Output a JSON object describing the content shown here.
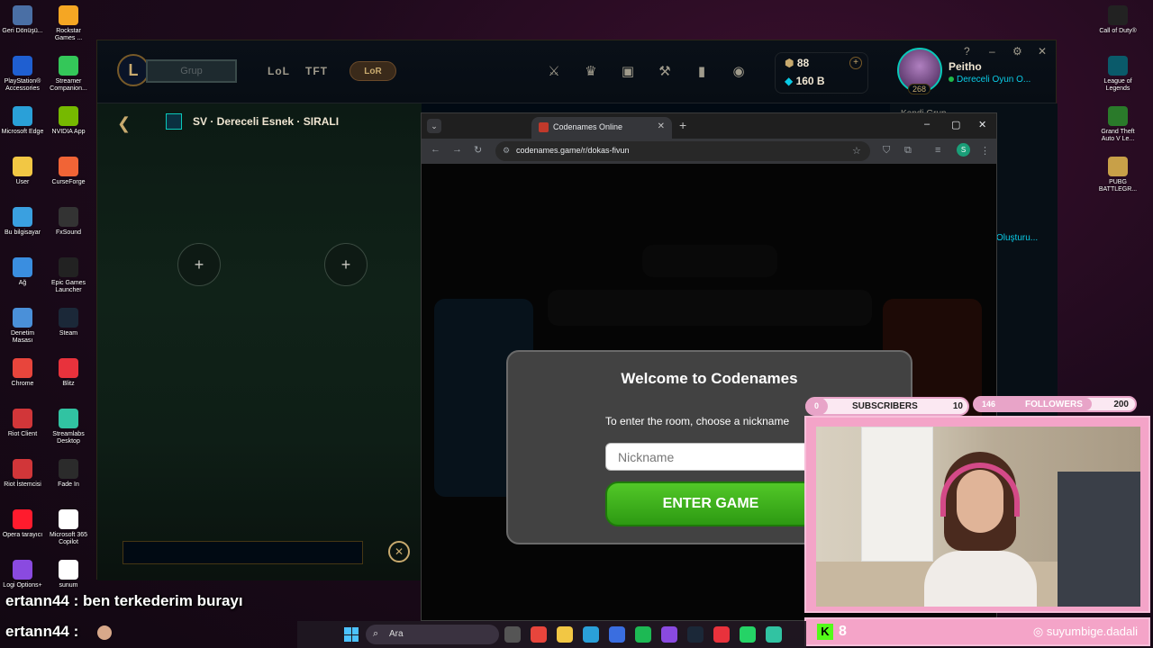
{
  "desktop": {
    "left_icons": [
      {
        "label": "Geri Dönüşü...",
        "icon": "recycle-bin-icon",
        "color": "#4a6fa5"
      },
      {
        "label": "Rockstar Games ...",
        "icon": "rockstar-icon",
        "color": "#f5a623"
      },
      {
        "label": "PlayStation® Accessories",
        "icon": "playstation-icon",
        "color": "#1f5fd1"
      },
      {
        "label": "Streamer Companion...",
        "icon": "streamer-icon",
        "color": "#34c759"
      },
      {
        "label": "Microsoft Edge",
        "icon": "edge-icon",
        "color": "#2aa0d8"
      },
      {
        "label": "NVIDIA App",
        "icon": "nvidia-icon",
        "color": "#76b900"
      },
      {
        "label": "User",
        "icon": "folder-icon",
        "color": "#f2c744"
      },
      {
        "label": "CurseForge",
        "icon": "curseforge-icon",
        "color": "#f16436"
      },
      {
        "label": "Bu bilgisayar",
        "icon": "computer-icon",
        "color": "#3aa0e0"
      },
      {
        "label": "FxSound",
        "icon": "fxsound-icon",
        "color": "#333333"
      },
      {
        "label": "Ağ",
        "icon": "network-icon",
        "color": "#3a8ee0"
      },
      {
        "label": "Epic Games Launcher",
        "icon": "epic-icon",
        "color": "#222222"
      },
      {
        "label": "Denetim Masası",
        "icon": "control-panel-icon",
        "color": "#4a90d9"
      },
      {
        "label": "Steam",
        "icon": "steam-icon",
        "color": "#1b2838"
      },
      {
        "label": "Chrome",
        "icon": "chrome-icon",
        "color": "#e8453c"
      },
      {
        "label": "Blitz",
        "icon": "blitz-icon",
        "color": "#e8323c"
      },
      {
        "label": "Riot Client",
        "icon": "riot-icon",
        "color": "#d13639"
      },
      {
        "label": "Streamlabs Desktop",
        "icon": "streamlabs-icon",
        "color": "#31c3a2"
      },
      {
        "label": "Riot İstemcisi",
        "icon": "riot-icon",
        "color": "#d13639"
      },
      {
        "label": "Fade In",
        "icon": "fadein-icon",
        "color": "#2b2b2b"
      },
      {
        "label": "Opera tarayıcı",
        "icon": "opera-icon",
        "color": "#ff1b2d"
      },
      {
        "label": "Microsoft 365 Copilot",
        "icon": "document-icon",
        "color": "#ffffff"
      },
      {
        "label": "Logi Options+",
        "icon": "logi-icon",
        "color": "#8a4ae0"
      },
      {
        "label": "sunum",
        "icon": "document-icon",
        "color": "#ffffff"
      }
    ],
    "right_icons": [
      {
        "label": "Call of Duty®",
        "icon": "cod-icon",
        "color": "#222222"
      },
      {
        "label": "League of Legends",
        "icon": "lol-icon",
        "color": "#0a5a6a"
      },
      {
        "label": "Grand Theft Auto V Le...",
        "icon": "gta-icon",
        "color": "#2a7a2a"
      },
      {
        "label": "PUBG BATTLEGR...",
        "icon": "pubg-icon",
        "color": "#c8a048"
      }
    ]
  },
  "lol_client": {
    "play_label": "Grup",
    "nav": [
      "LoL",
      "TFT"
    ],
    "lor_label": "LoR",
    "currency": {
      "rp": "88",
      "essence": "160 B"
    },
    "profile": {
      "name": "Peitho",
      "status": "Dereceli Oyun O...",
      "level": "268"
    },
    "lobby_title": "SV · Dereceli Esnek · SIRALI",
    "slot_plus": "+",
    "right_panel_title": "Kendi Grup...",
    "right_panel_link": "Oluşturu...",
    "close_glyph": "✕"
  },
  "browser": {
    "tab_title": "Codenames Online",
    "new_tab": "+",
    "url": "codenames.game/r/dokas-fivun",
    "profile_initial": "S"
  },
  "modal": {
    "title": "Welcome to Codenames",
    "text": "To enter the room, choose a nickname",
    "nickname_placeholder": "Nickname",
    "button": "ENTER GAME"
  },
  "overlay": {
    "subscribers": {
      "current": "0",
      "label": "SUBSCRIBERS",
      "goal": "10"
    },
    "followers": {
      "current": "146",
      "label": "FOLLOWERS",
      "goal": "200",
      "progress": 0.73
    },
    "kick_count": "8",
    "instagram": "suyumbige.dadali"
  },
  "chat": [
    {
      "user": "ertann44",
      "message": "ben terkederim burayı"
    },
    {
      "user": "ertann44",
      "message": ""
    }
  ],
  "taskbar": {
    "search_label": "Ara",
    "apps": [
      {
        "icon": "task-view-icon",
        "color": "#555555"
      },
      {
        "icon": "chrome-icon",
        "color": "#e8453c"
      },
      {
        "icon": "folder-icon",
        "color": "#f2c744"
      },
      {
        "icon": "edge-icon",
        "color": "#2aa0d8"
      },
      {
        "icon": "store-icon",
        "color": "#3a6ee0"
      },
      {
        "icon": "spotify-icon",
        "color": "#1db954"
      },
      {
        "icon": "copilot-icon",
        "color": "#8a4ae0"
      },
      {
        "icon": "steam-icon",
        "color": "#1b2838"
      },
      {
        "icon": "blitz-icon",
        "color": "#e8323c"
      },
      {
        "icon": "whatsapp-icon",
        "color": "#25d366"
      },
      {
        "icon": "app-icon",
        "color": "#31c3a2"
      }
    ]
  }
}
